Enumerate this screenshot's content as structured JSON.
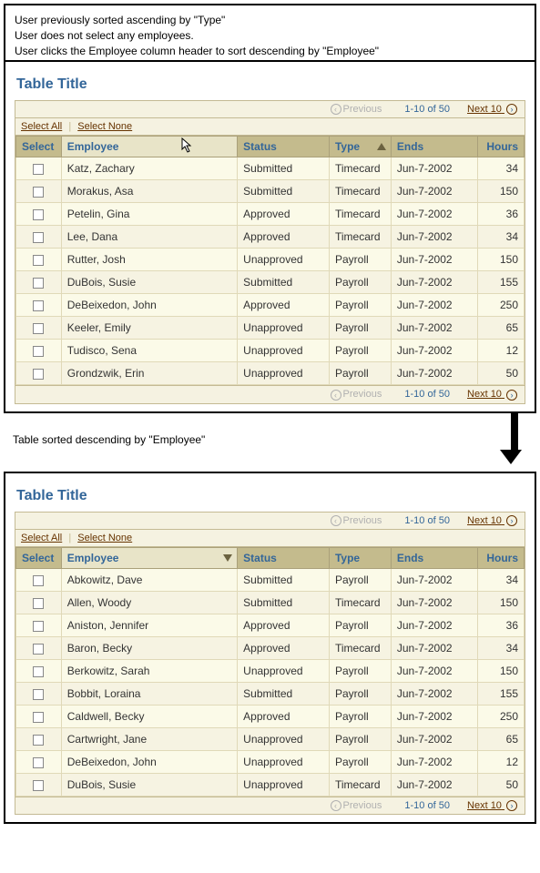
{
  "annotation": {
    "line1": "User previously sorted ascending by \"Type\"",
    "line2": "User does not select any employees.",
    "line3": "User clicks the Employee column header to sort descending by \"Employee\""
  },
  "between_label": "Table sorted descending by \"Employee\"",
  "title": "Table Title",
  "pager": {
    "previous": "Previous",
    "range": "1-10 of 50",
    "next": "Next 10"
  },
  "selects": {
    "all": "Select All",
    "none": "Select None"
  },
  "columns": {
    "select": "Select",
    "employee": "Employee",
    "status": "Status",
    "type": "Type",
    "ends": "Ends",
    "hours": "Hours"
  },
  "before": {
    "rows": [
      {
        "employee": "Katz, Zachary",
        "status": "Submitted",
        "type": "Timecard",
        "ends": "Jun-7-2002",
        "hours": "34"
      },
      {
        "employee": "Morakus, Asa",
        "status": "Submitted",
        "type": "Timecard",
        "ends": "Jun-7-2002",
        "hours": "150"
      },
      {
        "employee": "Petelin, Gina",
        "status": "Approved",
        "type": "Timecard",
        "ends": "Jun-7-2002",
        "hours": "36"
      },
      {
        "employee": "Lee, Dana",
        "status": "Approved",
        "type": "Timecard",
        "ends": "Jun-7-2002",
        "hours": "34"
      },
      {
        "employee": "Rutter, Josh",
        "status": "Unapproved",
        "type": "Payroll",
        "ends": "Jun-7-2002",
        "hours": "150"
      },
      {
        "employee": "DuBois, Susie",
        "status": "Submitted",
        "type": "Payroll",
        "ends": "Jun-7-2002",
        "hours": "155"
      },
      {
        "employee": "DeBeixedon, John",
        "status": "Approved",
        "type": "Payroll",
        "ends": "Jun-7-2002",
        "hours": "250"
      },
      {
        "employee": "Keeler, Emily",
        "status": "Unapproved",
        "type": "Payroll",
        "ends": "Jun-7-2002",
        "hours": "65"
      },
      {
        "employee": "Tudisco, Sena",
        "status": "Unapproved",
        "type": "Payroll",
        "ends": "Jun-7-2002",
        "hours": "12"
      },
      {
        "employee": "Grondzwik, Erin",
        "status": "Unapproved",
        "type": "Payroll",
        "ends": "Jun-7-2002",
        "hours": "50"
      }
    ]
  },
  "after": {
    "rows": [
      {
        "employee": "Abkowitz, Dave",
        "status": "Submitted",
        "type": "Payroll",
        "ends": "Jun-7-2002",
        "hours": "34"
      },
      {
        "employee": "Allen, Woody",
        "status": "Submitted",
        "type": "Timecard",
        "ends": "Jun-7-2002",
        "hours": "150"
      },
      {
        "employee": "Aniston, Jennifer",
        "status": "Approved",
        "type": "Payroll",
        "ends": "Jun-7-2002",
        "hours": "36"
      },
      {
        "employee": "Baron, Becky",
        "status": "Approved",
        "type": "Timecard",
        "ends": "Jun-7-2002",
        "hours": "34"
      },
      {
        "employee": "Berkowitz, Sarah",
        "status": "Unapproved",
        "type": "Payroll",
        "ends": "Jun-7-2002",
        "hours": "150"
      },
      {
        "employee": "Bobbit, Loraina",
        "status": "Submitted",
        "type": "Payroll",
        "ends": "Jun-7-2002",
        "hours": "155"
      },
      {
        "employee": "Caldwell, Becky",
        "status": "Approved",
        "type": "Payroll",
        "ends": "Jun-7-2002",
        "hours": "250"
      },
      {
        "employee": "Cartwright, Jane",
        "status": "Unapproved",
        "type": "Payroll",
        "ends": "Jun-7-2002",
        "hours": "65"
      },
      {
        "employee": "DeBeixedon, John",
        "status": "Unapproved",
        "type": "Payroll",
        "ends": "Jun-7-2002",
        "hours": "12"
      },
      {
        "employee": "DuBois, Susie",
        "status": "Unapproved",
        "type": "Timecard",
        "ends": "Jun-7-2002",
        "hours": "50"
      }
    ]
  }
}
